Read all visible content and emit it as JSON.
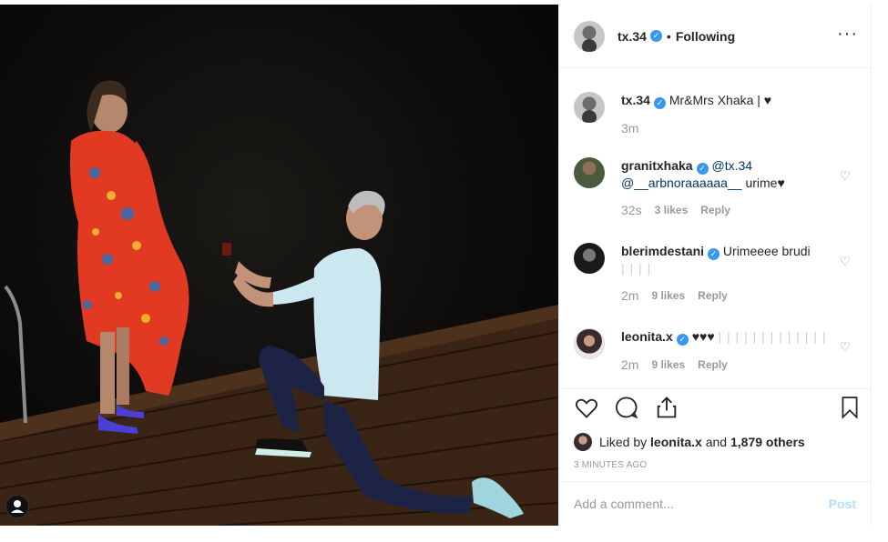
{
  "header": {
    "username": "tx.34",
    "separator": "•",
    "follow_status": "Following",
    "more": "···"
  },
  "caption": {
    "username": "tx.34",
    "text": "Mr&Mrs Xhaka",
    "suffix": "| ♥",
    "time": "3m"
  },
  "comments": [
    {
      "username": "granitxhaka",
      "mention1": "@tx.34",
      "mention2": "@__arbnoraaaaaa__",
      "text": "urime♥",
      "time": "32s",
      "likes": "3 likes",
      "reply": "Reply"
    },
    {
      "username": "blerimdestani",
      "text": "Urimeeee brudi",
      "extra": "| | | |",
      "time": "2m",
      "likes": "9 likes",
      "reply": "Reply"
    },
    {
      "username": "leonita.x",
      "text": "♥♥♥",
      "extra": "| | | | | | | | | | | | |",
      "time": "2m",
      "likes": "9 likes",
      "reply": "Reply"
    }
  ],
  "likes": {
    "prefix": "Liked by",
    "user": "leonita.x",
    "and": "and",
    "others": "1,879 others"
  },
  "timestamp": "3 MINUTES AGO",
  "add_comment": {
    "placeholder": "Add a comment...",
    "post": "Post"
  },
  "colors": {
    "verified": "#3897f0",
    "mention": "#003569",
    "muted": "#999999",
    "post_disabled": "#b2dffc"
  },
  "icons": [
    "heart-icon",
    "comment-icon",
    "share-icon",
    "bookmark-icon",
    "verified-icon",
    "user-tag-icon"
  ]
}
